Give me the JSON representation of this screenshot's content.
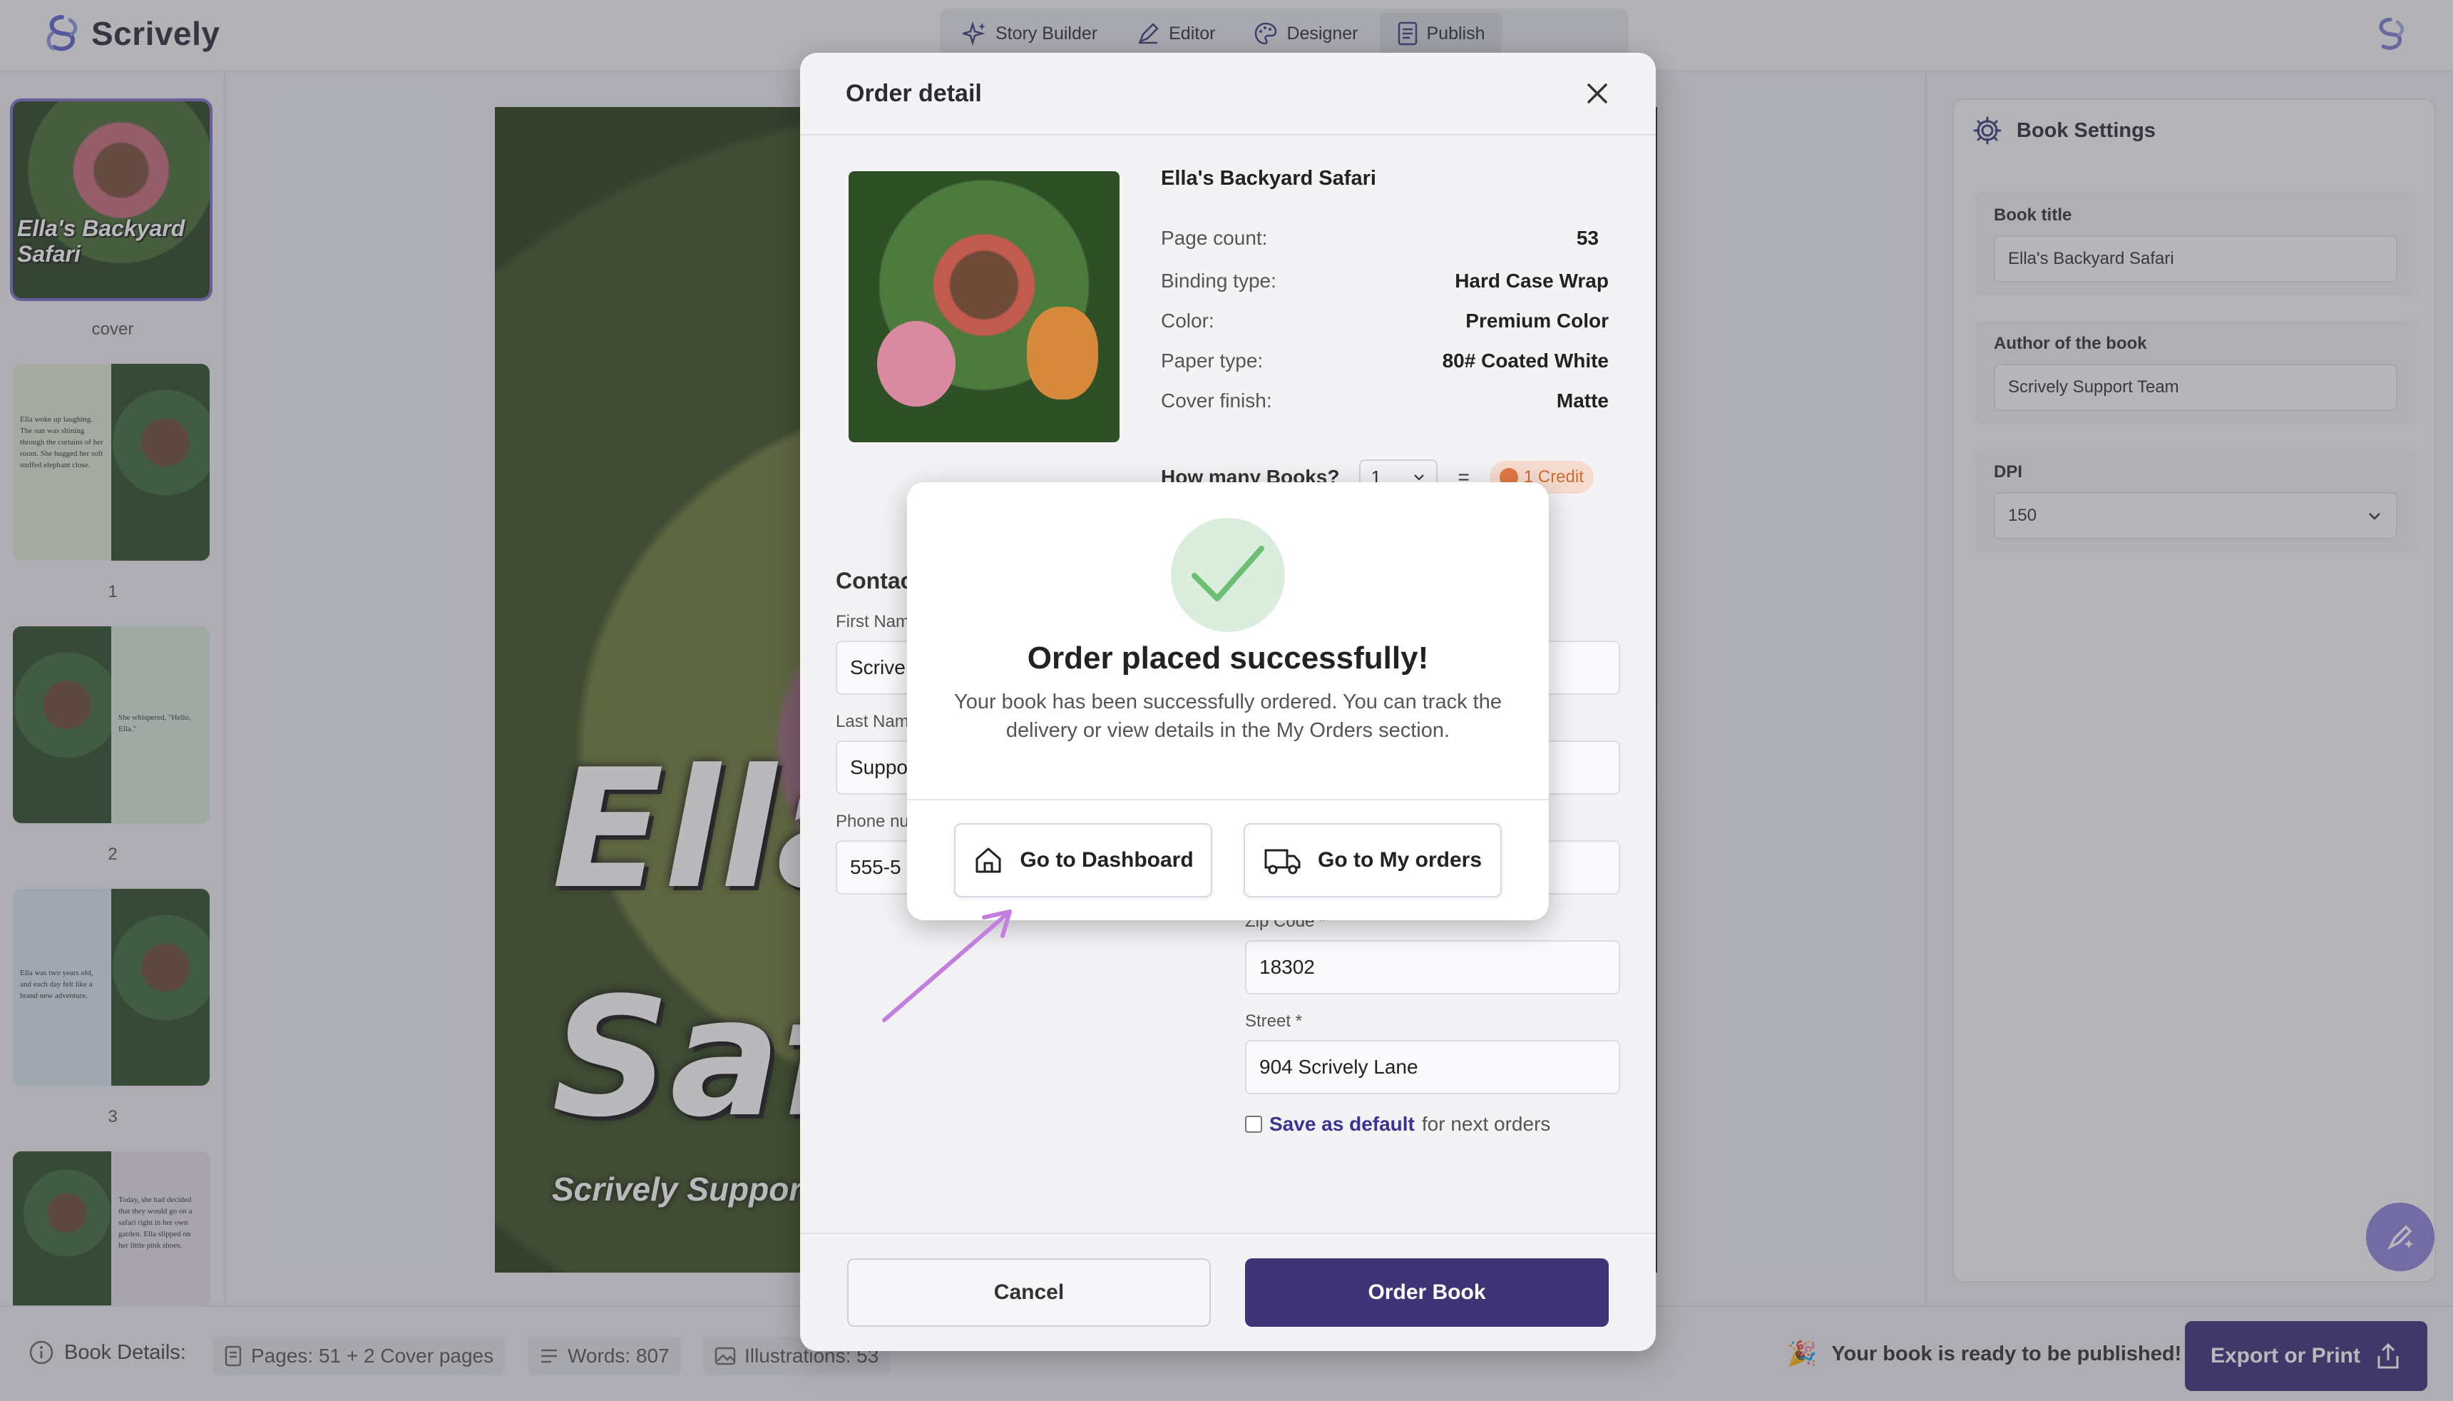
{
  "app": {
    "name": "Scrively"
  },
  "tabs": [
    {
      "label": "Story Builder",
      "icon": "sparkles-icon"
    },
    {
      "label": "Editor",
      "icon": "pen-icon"
    },
    {
      "label": "Designer",
      "icon": "palette-icon"
    },
    {
      "label": "Publish",
      "icon": "document-icon",
      "active": true
    }
  ],
  "thumbnails": [
    {
      "label": "cover",
      "cover_title": "Ella's Backyard Safari"
    },
    {
      "label": "1",
      "text": "Ella woke up laughing. The sun was shining through the curtains of her room. She hugged her soft stuffed elephant close."
    },
    {
      "label": "2",
      "text": "She whispered, \"Hello, Ella.\""
    },
    {
      "label": "3",
      "text": "Ella was two years old, and each day felt like a brand new adventure."
    },
    {
      "label": "",
      "text": "Today, she had decided that they would go on a safari right in her own garden. Ella slipped on her little pink shoes."
    }
  ],
  "cover": {
    "title_line1": "Ella",
    "title_line2": "Safa",
    "author": "Scrively Support Te"
  },
  "settings": {
    "title": "Book Settings",
    "book_title_label": "Book title",
    "book_title": "Ella's Backyard Safari",
    "author_label": "Author of the book",
    "author": "Scrively Support Team",
    "dpi_label": "DPI",
    "dpi": "150"
  },
  "bottom": {
    "details_label": "Book Details:",
    "pages": "Pages: 51 + 2 Cover pages",
    "words": "Words: 807",
    "illustrations": "Illustrations: 53",
    "ready": "Your book is ready to be published!",
    "export": "Export or Print"
  },
  "order": {
    "title": "Order detail",
    "book_name": "Ella's Backyard Safari",
    "specs": [
      {
        "k": "Page count:",
        "v": "53"
      },
      {
        "k": "Binding type:",
        "v": "Hard Case Wrap"
      },
      {
        "k": "Color:",
        "v": "Premium Color"
      },
      {
        "k": "Paper type:",
        "v": "80# Coated White"
      },
      {
        "k": "Cover finish:",
        "v": "Matte"
      }
    ],
    "how_many_label": "How many Books?",
    "quantity": "1",
    "equals": "=",
    "credit": "1 Credit",
    "contact_title": "Contac",
    "first_name_label": "First Nam",
    "first_name": "Scrive",
    "last_name_label": "Last Nam",
    "last_name": "Suppo",
    "phone_label": "Phone nu",
    "phone": "555-5",
    "zip_label": "Zip Code *",
    "zip": "18302",
    "street_label": "Street *",
    "street": "904 Scrively Lane",
    "save_default_bold": "Save as default",
    "save_default_rest": "for next orders",
    "cancel": "Cancel",
    "submit": "Order Book"
  },
  "success": {
    "title": "Order placed successfully!",
    "message": "Your book has been successfully ordered. You can track the delivery or view details in the My Orders section.",
    "dashboard_btn": "Go to Dashboard",
    "orders_btn": "Go to My orders"
  },
  "colors": {
    "accent": "#3f3576",
    "success_bg": "#dbeedd",
    "success_check": "#6cbf75",
    "arrow": "#c47ee0"
  }
}
